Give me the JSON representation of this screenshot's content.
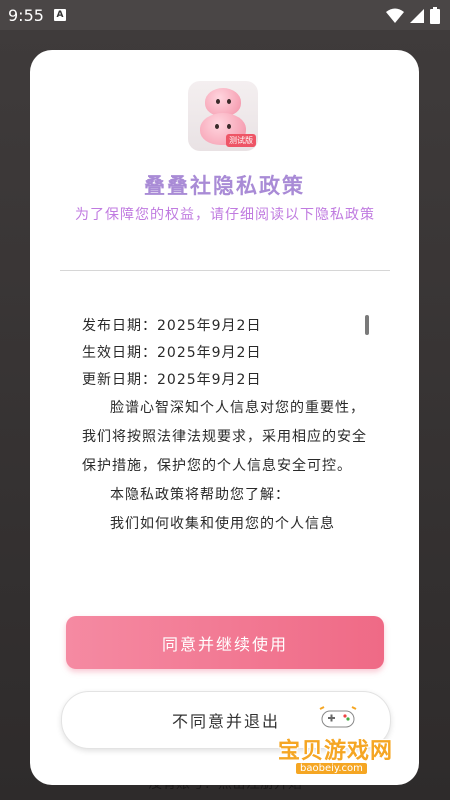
{
  "status": {
    "time": "9:55",
    "app_icon_letter": "A"
  },
  "background": {
    "bottom_text": "没有账号？点击注册开始"
  },
  "dialog": {
    "badge": "测试版",
    "title": "叠叠社隐私政策",
    "subtitle": "为了保障您的权益，请仔细阅读以下隐私政策",
    "dates": [
      "发布日期：2025年9月2日",
      "生效日期：2025年9月2日",
      "更新日期：2025年9月2日"
    ],
    "paragraphs": [
      "脸谱心智深知个人信息对您的重要性，我们将按照法律法规要求，采用相应的安全保护措施，保护您的个人信息安全可控。",
      "本隐私政策将帮助您了解：",
      "我们如何收集和使用您的个人信息"
    ],
    "agree_label": "同意并继续使用",
    "disagree_label": "不同意并退出"
  },
  "watermark": {
    "text": "宝贝游戏网",
    "url": "baobeiy.com"
  },
  "colors": {
    "accent_pink": "#ef6a86",
    "title_purple": "#a98bd6",
    "subtitle_purple": "#c07be0"
  }
}
